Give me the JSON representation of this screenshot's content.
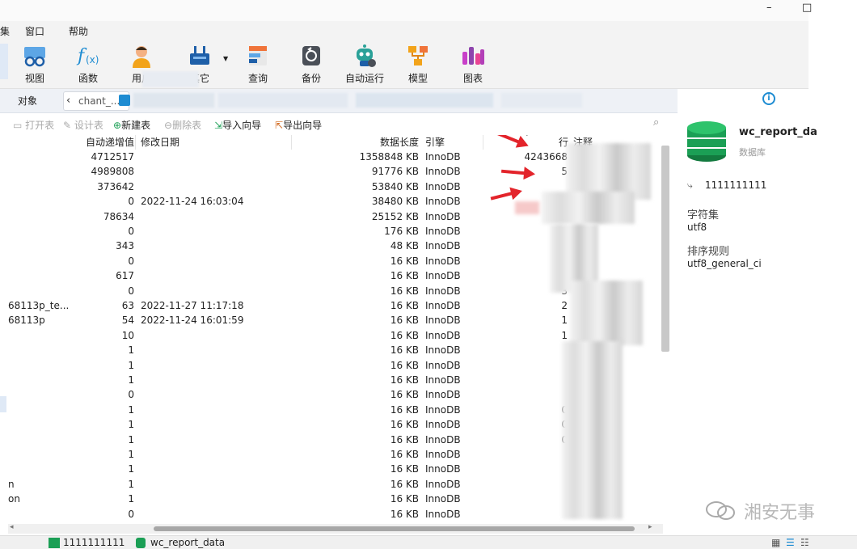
{
  "menu": {
    "item0": "集",
    "window": "窗口",
    "help": "帮助"
  },
  "window_controls": {
    "minimize": "–",
    "maximize": "□"
  },
  "toolbar": {
    "view": "视图",
    "function": "函数",
    "user": "用户",
    "other": "其它",
    "query": "查询",
    "backup": "备份",
    "automation": "自动运行",
    "model": "模型",
    "chart": "图表"
  },
  "tabs": {
    "objects": "对象",
    "crumb": "chant_..."
  },
  "actions": {
    "open_table": "打开表",
    "design_table": "设计表",
    "new_table": "新建表",
    "delete_table": "删除表",
    "import_wizard": "导入向导",
    "export_wizard": "导出向导"
  },
  "columns": {
    "auto_increment": "自动递增值",
    "modified": "修改日期",
    "data_length": "数据长度",
    "engine": "引擎",
    "rows": "行",
    "comment": "注释"
  },
  "rows": [
    {
      "name": "",
      "auto": "4712517",
      "date": "",
      "len": "1358848 KB",
      "engine": "InnoDB",
      "rows": "4243668"
    },
    {
      "name": "",
      "auto": "4989808",
      "date": "",
      "len": "91776 KB",
      "engine": "InnoDB",
      "rows": "5"
    },
    {
      "name": "",
      "auto": "373642",
      "date": "",
      "len": "53840 KB",
      "engine": "InnoDB",
      "rows": ""
    },
    {
      "name": "",
      "auto": "0",
      "date": "2022-11-24 16:03:04",
      "len": "38480 KB",
      "engine": "InnoDB",
      "rows": ""
    },
    {
      "name": "",
      "auto": "78634",
      "date": "",
      "len": "25152 KB",
      "engine": "InnoDB",
      "rows": ""
    },
    {
      "name": "",
      "auto": "0",
      "date": "",
      "len": "176 KB",
      "engine": "InnoDB",
      "rows": ""
    },
    {
      "name": "",
      "auto": "343",
      "date": "",
      "len": "48 KB",
      "engine": "InnoDB",
      "rows": ""
    },
    {
      "name": "",
      "auto": "0",
      "date": "",
      "len": "16 KB",
      "engine": "InnoDB",
      "rows": "3"
    },
    {
      "name": "",
      "auto": "617",
      "date": "",
      "len": "16 KB",
      "engine": "InnoDB",
      "rows": "2"
    },
    {
      "name": "",
      "auto": "0",
      "date": "",
      "len": "16 KB",
      "engine": "InnoDB",
      "rows": "3"
    },
    {
      "name": "68113p_te...",
      "auto": "63",
      "date": "2022-11-27 11:17:18",
      "len": "16 KB",
      "engine": "InnoDB",
      "rows": "2"
    },
    {
      "name": "68113p",
      "auto": "54",
      "date": "2022-11-24 16:01:59",
      "len": "16 KB",
      "engine": "InnoDB",
      "rows": "1"
    },
    {
      "name": "",
      "auto": "10",
      "date": "",
      "len": "16 KB",
      "engine": "InnoDB",
      "rows": "1"
    },
    {
      "name": "",
      "auto": "1",
      "date": "",
      "len": "16 KB",
      "engine": "InnoDB",
      "rows": ""
    },
    {
      "name": "",
      "auto": "1",
      "date": "",
      "len": "16 KB",
      "engine": "InnoDB",
      "rows": ""
    },
    {
      "name": "",
      "auto": "1",
      "date": "",
      "len": "16 KB",
      "engine": "InnoDB",
      "rows": ""
    },
    {
      "name": "",
      "auto": "0",
      "date": "",
      "len": "16 KB",
      "engine": "InnoDB",
      "rows": ""
    },
    {
      "name": "",
      "auto": "1",
      "date": "",
      "len": "16 KB",
      "engine": "InnoDB",
      "rows": "0"
    },
    {
      "name": "",
      "auto": "1",
      "date": "",
      "len": "16 KB",
      "engine": "InnoDB",
      "rows": "0"
    },
    {
      "name": "",
      "auto": "1",
      "date": "",
      "len": "16 KB",
      "engine": "InnoDB",
      "rows": "0"
    },
    {
      "name": "",
      "auto": "1",
      "date": "",
      "len": "16 KB",
      "engine": "InnoDB",
      "rows": ""
    },
    {
      "name": "",
      "auto": "1",
      "date": "",
      "len": "16 KB",
      "engine": "InnoDB",
      "rows": ""
    },
    {
      "name": "n",
      "auto": "1",
      "date": "",
      "len": "16 KB",
      "engine": "InnoDB",
      "rows": ""
    },
    {
      "name": "on",
      "auto": "1",
      "date": "",
      "len": "16 KB",
      "engine": "InnoDB",
      "rows": ""
    },
    {
      "name": "",
      "auto": "0",
      "date": "",
      "len": "16 KB",
      "engine": "InnoDB",
      "rows": ""
    }
  ],
  "info_panel": {
    "db_name": "wc_report_da",
    "db_type": "数据库",
    "connection": "1111111111",
    "charset_label": "字符集",
    "charset_value": "utf8",
    "collation_label": "排序规则",
    "collation_value": "utf8_general_ci"
  },
  "status": {
    "connection": "1111111111",
    "database": "wc_report_data"
  },
  "watermark": {
    "text": "湘安无事"
  },
  "colors": {
    "accent": "#1e8cd2",
    "db_green": "#1b9f55",
    "arrow_red": "#e3242b",
    "toolbar_bg": "#f3f3f3"
  }
}
